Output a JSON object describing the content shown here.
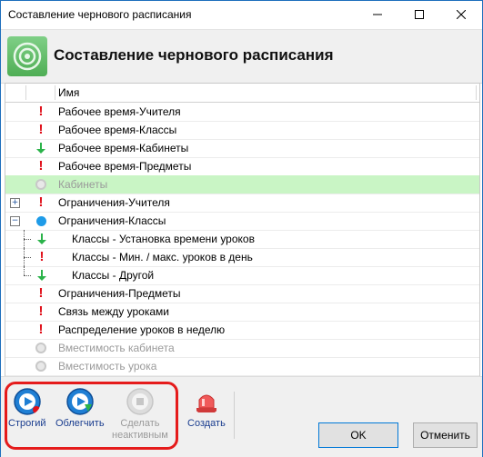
{
  "window": {
    "title": "Составление чернового расписания"
  },
  "header": {
    "title": "Составление чернового расписания"
  },
  "grid": {
    "column_header": "Имя",
    "rows": [
      {
        "label": "Рабочее время-Учителя",
        "status": "error"
      },
      {
        "label": "Рабочее время-Классы",
        "status": "error"
      },
      {
        "label": "Рабочее время-Кабинеты",
        "status": "ok"
      },
      {
        "label": "Рабочее время-Предметы",
        "status": "error"
      },
      {
        "label": "Кабинеты",
        "status": "inactive",
        "selected": true
      },
      {
        "label": "Ограничения-Учителя",
        "status": "error",
        "expander": "+"
      },
      {
        "label": "Ограничения-Классы",
        "status": "in-progress",
        "expander": "−"
      },
      {
        "label": "Классы - Установка времени уроков",
        "status": "ok",
        "child": true
      },
      {
        "label": "Классы - Мин. / макс. уроков в день",
        "status": "error",
        "child": true
      },
      {
        "label": "Классы - Другой",
        "status": "ok",
        "child": true
      },
      {
        "label": "Ограничения-Предметы",
        "status": "error"
      },
      {
        "label": "Связь между уроками",
        "status": "error"
      },
      {
        "label": "Распределение уроков в неделю",
        "status": "error"
      },
      {
        "label": "Вместимость кабинета",
        "status": "inactive"
      },
      {
        "label": "Вместимость урока",
        "status": "inactive"
      }
    ]
  },
  "toolbar": {
    "strict_label": "Строгий",
    "ease_label": "Облегчить",
    "inactive_label_1": "Сделать",
    "inactive_label_2": "неактивным",
    "create_label": "Создать"
  },
  "buttons": {
    "ok": "OK",
    "cancel": "Отменить"
  },
  "colors": {
    "selection": "#c9f5c5",
    "error": "#e0101a",
    "ok": "#2bb34a",
    "accent": "#1e9be8",
    "highlight_box": "#e51b1b"
  }
}
